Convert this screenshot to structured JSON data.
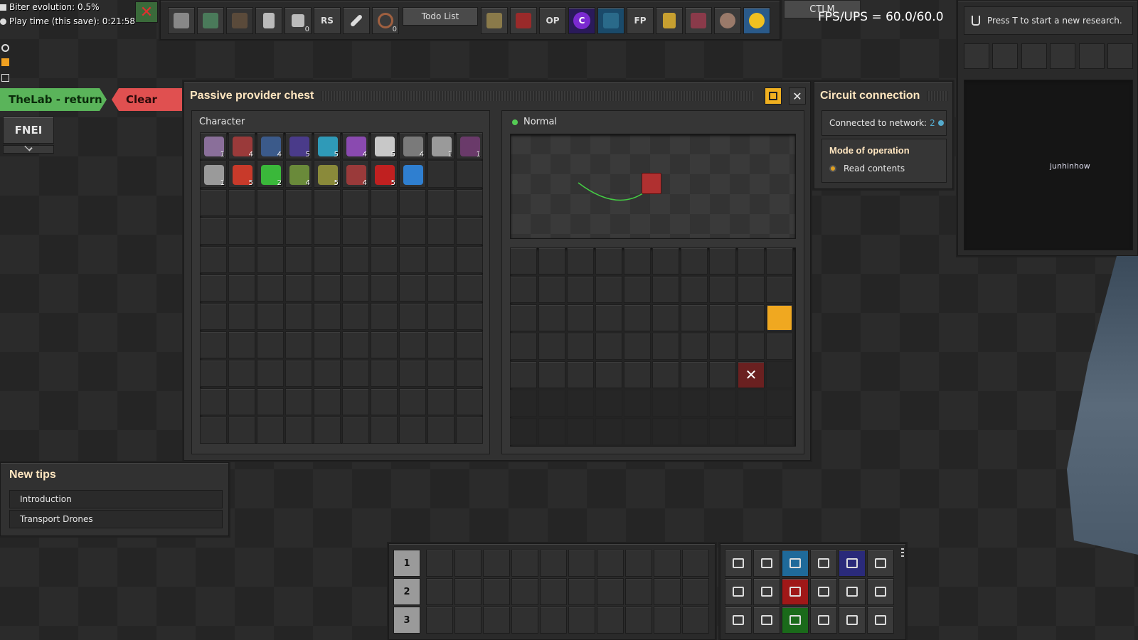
{
  "hud": {
    "biter_evolution": "Biter evolution: 0.5%",
    "play_time": "Play time (this save): 0:21:58",
    "fps_ups": "FPS/UPS = 60.0/60.0",
    "ctlm": "CTLM"
  },
  "toolbar": {
    "rs": "RS",
    "todo": "Todo List",
    "op": "OP",
    "c": "C",
    "fp": "FP",
    "list_count": "0",
    "wire_count": "0"
  },
  "left": {
    "thelab_return": "TheLab - return",
    "clear": "Clear",
    "fnei": "FNEI"
  },
  "chest": {
    "title": "Passive provider chest",
    "character_label": "Character",
    "status": "Normal",
    "inventory": [
      {
        "icon": "substation-icon",
        "count": "1",
        "color": "#8a6f9a"
      },
      {
        "icon": "assembler-icon",
        "count": "4",
        "color": "#9a3a3a"
      },
      {
        "icon": "assembler-blue-icon",
        "count": "4",
        "color": "#3b5a8a"
      },
      {
        "icon": "assembler-purple-icon",
        "count": "5",
        "color": "#4a3b8a"
      },
      {
        "icon": "inserter-cyan-icon",
        "count": "5",
        "color": "#2f9ab8"
      },
      {
        "icon": "inserter-purple-icon",
        "count": "4",
        "color": "#8a4ab0"
      },
      {
        "icon": "inserter-white-icon",
        "count": "5",
        "color": "#c8c8c8"
      },
      {
        "icon": "power-pole-icon",
        "count": "4",
        "color": "#7a7a7a"
      },
      {
        "icon": "power-pole-small-icon",
        "count": "1",
        "color": "#9a9a9a"
      },
      {
        "icon": "furnace-icon",
        "count": "1",
        "color": "#6a3a6a"
      },
      {
        "icon": "roboport-icon",
        "count": "1",
        "color": "#9a9a9a"
      },
      {
        "icon": "red-wire-icon",
        "count": "5",
        "color": "#c83a2a"
      },
      {
        "icon": "green-wire-icon",
        "count": "2",
        "color": "#3ab83a"
      },
      {
        "icon": "constant-combinator-icon",
        "count": "4",
        "color": "#6a8a3a"
      },
      {
        "icon": "decider-combinator-icon",
        "count": "5",
        "color": "#8a8a3a"
      },
      {
        "icon": "chest-red-icon",
        "count": "4",
        "color": "#9a3a3a"
      },
      {
        "icon": "chest-passive-icon",
        "count": "5",
        "color": "#c02020"
      },
      {
        "icon": "blueprint-icon",
        "count": "",
        "color": "#2f7fd0"
      }
    ]
  },
  "circuit": {
    "title": "Circuit connection",
    "connected": "Connected to network:",
    "network_id": "2",
    "mode_title": "Mode of operation",
    "mode_value": "Read contents"
  },
  "research": {
    "text": "Press T to start a new research."
  },
  "minimap": {
    "player": "junhinhow"
  },
  "tips": {
    "title": "New tips",
    "items": [
      "Introduction",
      "Transport Drones"
    ]
  },
  "hotbar": {
    "rows": [
      "1",
      "2",
      "3"
    ]
  }
}
